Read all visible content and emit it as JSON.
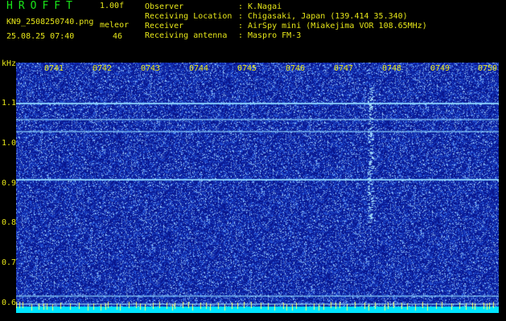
{
  "header": {
    "app_title": "HROFFT",
    "version": "1.00f",
    "filename": "KN9_2508250740.png",
    "mode": "meleor",
    "datetime": "25.08.25 07:40",
    "count": "46"
  },
  "info": [
    {
      "label": "Observer",
      "value": "K.Nagai"
    },
    {
      "label": "Receiving Location",
      "value": "Chigasaki, Japan (139.414 35.340)"
    },
    {
      "label": "Receiver",
      "value": "AirSpy mini (Miakejima VOR 108.65MHz)"
    },
    {
      "label": "Receiving antenna",
      "value": "Maspro FM-3"
    }
  ],
  "separator": ":",
  "spectrogram": {
    "y_unit": "kHz",
    "y_ticks": [
      "1.1",
      "1.0",
      "0.9",
      "0.8",
      "0.7",
      "0.6"
    ],
    "x_ticks": [
      "0741",
      "0742",
      "0743",
      "0744",
      "0745",
      "0746",
      "0747",
      "0748",
      "0749",
      "0750"
    ],
    "colors": {
      "background": "#000000",
      "noise_base": "#0a1a8a",
      "signal": "#8fd8ff",
      "baseline": "#00e5ff"
    },
    "carriers_khz": [
      1.1,
      1.06,
      1.03,
      0.91,
      0.62,
      0.6
    ],
    "meteor_time": "0747"
  }
}
